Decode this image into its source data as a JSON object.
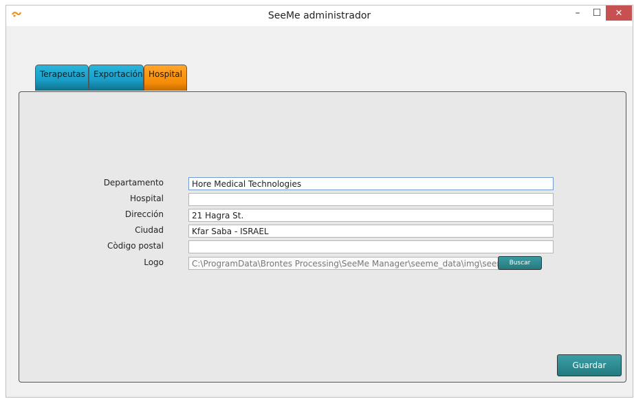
{
  "window": {
    "title": "SeeMe administrador",
    "minimize_label": "–",
    "maximize_label": "☐",
    "close_label": "✕"
  },
  "tabs": [
    {
      "label": "Terapeutas"
    },
    {
      "label": "Exportación"
    },
    {
      "label": "Hospital"
    }
  ],
  "form": {
    "fields": [
      {
        "label": "Departamento",
        "value": "Hore Medical Technologies"
      },
      {
        "label": "Hospital",
        "value": ""
      },
      {
        "label": "Dirección",
        "value": "21 Hagra St."
      },
      {
        "label": "Ciudad",
        "value": "Kfar Saba - ISRAEL"
      },
      {
        "label": "Còdigo postal",
        "value": ""
      },
      {
        "label": "Logo",
        "value": "C:\\ProgramData\\Brontes Processing\\SeeMe Manager\\seeme_data\\img\\seeme.png"
      }
    ],
    "browse_label": "Buscar",
    "save_label": "Guardar"
  },
  "colors": {
    "tab_active": "#f48c06",
    "tab_inactive": "#1a9cc6",
    "button": "#2a8a90",
    "close_button": "#c75050"
  }
}
